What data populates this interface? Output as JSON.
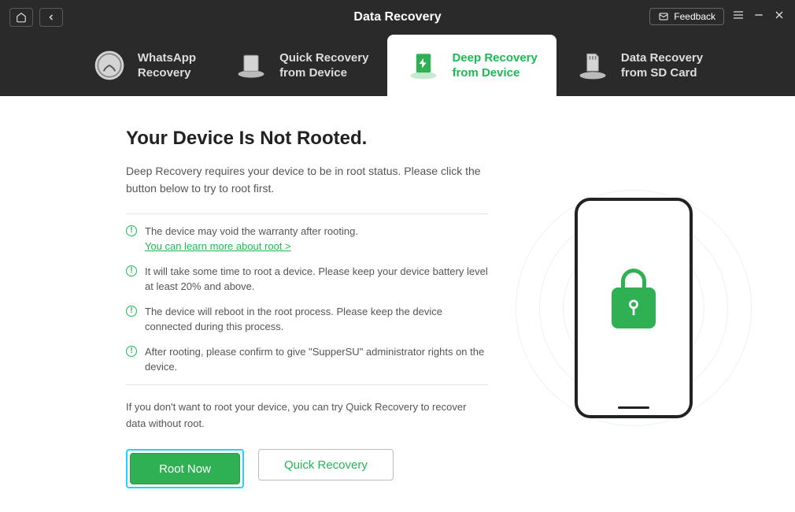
{
  "titlebar": {
    "title": "Data Recovery",
    "feedback_label": "Feedback"
  },
  "tabs": [
    {
      "line1": "WhatsApp",
      "line2": "Recovery"
    },
    {
      "line1": "Quick Recovery",
      "line2": "from Device"
    },
    {
      "line1": "Deep Recovery",
      "line2": "from Device"
    },
    {
      "line1": "Data Recovery",
      "line2": "from SD Card"
    }
  ],
  "main": {
    "heading": "Your Device Is Not Rooted.",
    "description": "Deep Recovery requires your device to be in root status. Please click the button below to try to root first.",
    "warnings": [
      {
        "text": "The device may void the warranty after rooting.",
        "link": "You can learn more about root >"
      },
      {
        "text": "It will take some time to root a device. Please keep your device battery level at least 20% and above."
      },
      {
        "text": "The device will reboot in the root process. Please keep the device connected during this process."
      },
      {
        "text": "After rooting, please confirm to give \"SupperSU\" administrator rights on the device."
      }
    ],
    "alt_text": "If you don't want to root your device, you can try Quick Recovery to recover data without root.",
    "btn_primary": "Root Now",
    "btn_secondary": "Quick Recovery"
  }
}
